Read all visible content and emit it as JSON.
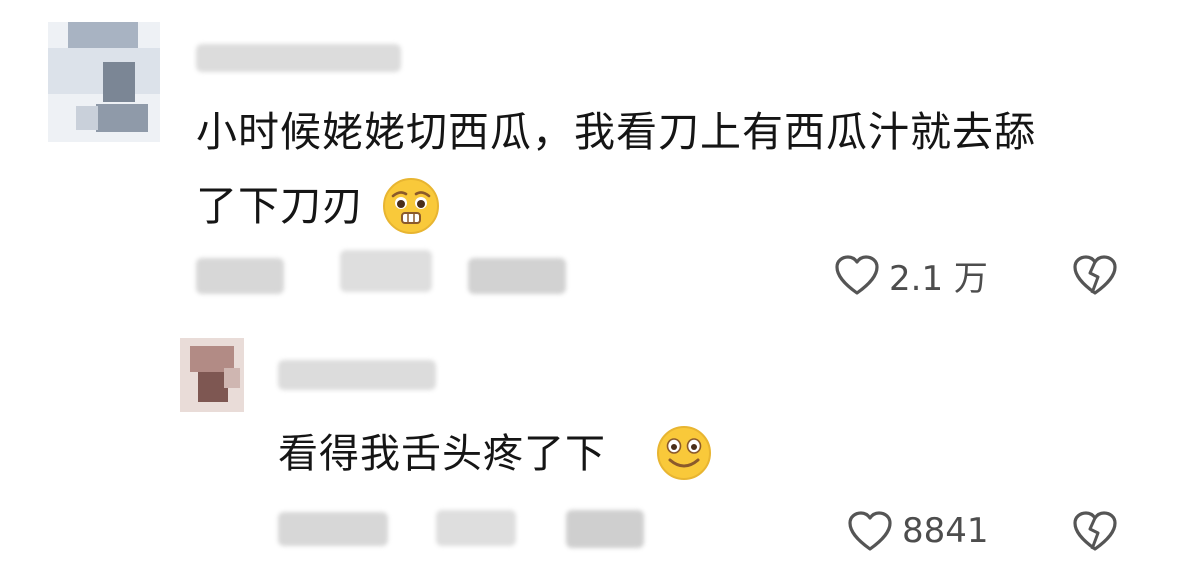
{
  "comments": [
    {
      "text_line1": "小时候姥姥切西瓜，我看刀上有西瓜汁就去舔",
      "text_line2": "了下刀刃",
      "like_count": "2.1 万",
      "emoji": "worried-face-with-teeth"
    },
    {
      "text": "看得我舌头疼了下",
      "like_count": "8841",
      "emoji": "smiling-face"
    }
  ],
  "icons": {
    "like": "heart-outline-icon",
    "dislike": "broken-heart-outline-icon"
  },
  "colors": {
    "text": "#151515",
    "icon": "#555555",
    "emoji_face": "#F9C93A",
    "blur_gray": "#D9D9D9"
  }
}
